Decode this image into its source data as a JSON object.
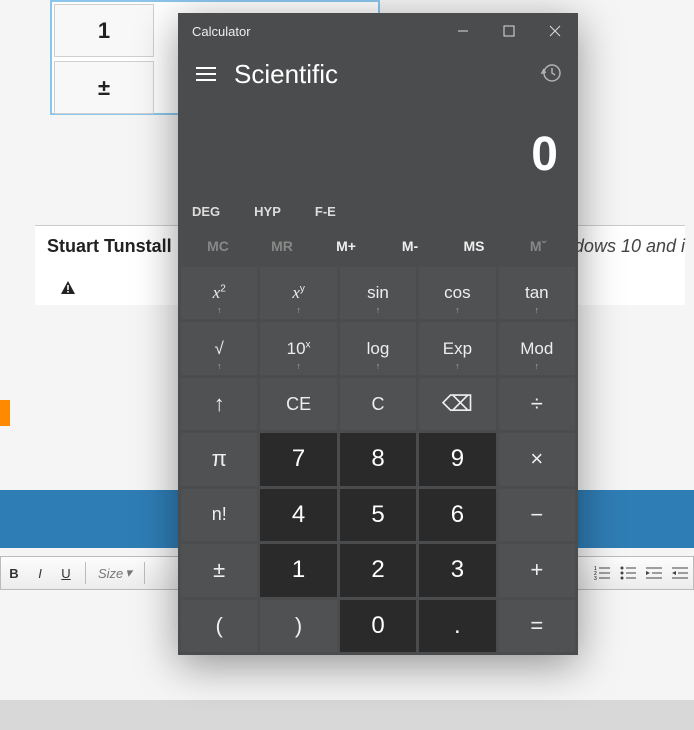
{
  "bg": {
    "calc_cells": [
      "1",
      "±"
    ],
    "author": "Stuart Tunstall",
    "tail_text": "dows 10 and i",
    "toolbar": {
      "size_label": "Size"
    }
  },
  "calc": {
    "title": "Calculator",
    "mode": "Scientific",
    "display": "0",
    "mode_row": {
      "deg": "DEG",
      "hyp": "HYP",
      "fe": "F-E"
    },
    "mem": {
      "mc": "MC",
      "mr": "MR",
      "mplus": "M+",
      "mminus": "M-",
      "ms": "MS",
      "mlist": "Mˇ"
    },
    "keys": {
      "r1": {
        "xsq": "x",
        "xy": "x",
        "sin": "sin",
        "cos": "cos",
        "tan": "tan"
      },
      "r2": {
        "sqrt": "√",
        "tenx": "10",
        "log": "log",
        "exp": "Exp",
        "mod": "Mod"
      },
      "r3": {
        "up": "↑",
        "ce": "CE",
        "c": "C",
        "back": "⌫",
        "div": "÷"
      },
      "r4": {
        "pi": "π",
        "n7": "7",
        "n8": "8",
        "n9": "9",
        "mul": "×"
      },
      "r5": {
        "fact": "n!",
        "n4": "4",
        "n5": "5",
        "n6": "6",
        "sub": "−"
      },
      "r6": {
        "pm": "±",
        "n1": "1",
        "n2": "2",
        "n3": "3",
        "add": "+"
      },
      "r7": {
        "lp": "(",
        "rp": ")",
        "n0": "0",
        "dot": ".",
        "eq": "="
      }
    }
  }
}
